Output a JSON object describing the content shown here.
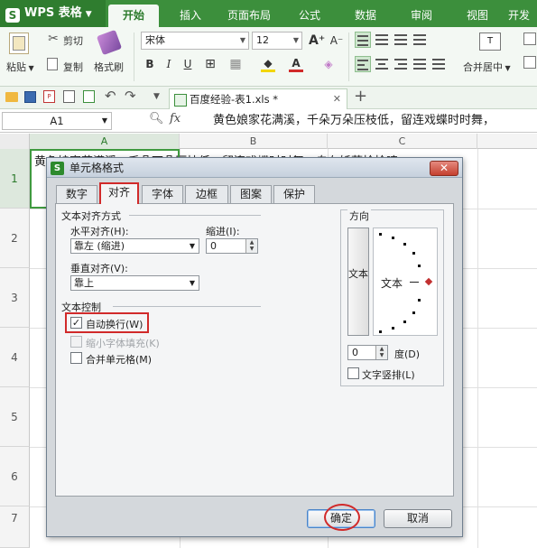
{
  "app": {
    "logo_label": "WPS 表格"
  },
  "ribbon_tabs": [
    "开始",
    "插入",
    "页面布局",
    "公式",
    "数据",
    "审阅",
    "视图",
    "开发"
  ],
  "ribbon": {
    "paste_label": "粘贴",
    "cut_label": "剪切",
    "copy_label": "复制",
    "format_painter_label": "格式刷",
    "font_name": "宋体",
    "font_size": "12",
    "merge_label": "合并居中"
  },
  "doc_tab": {
    "title": "百度经验-表1.xls *"
  },
  "formula_bar": {
    "name_box": "A1",
    "fx": "fx",
    "content": "黄色娘家花满溪，千朵万朵压枝低，留连戏蝶时时舞，"
  },
  "sheet": {
    "columns": [
      "A",
      "B",
      "C"
    ],
    "rows": [
      "1",
      "2",
      "3",
      "4",
      "5",
      "6",
      "7"
    ],
    "a1_visible": "黄色娘家花满溪，千朵万朵压枝低，留连戏蝶时时舞，自在娇莺恰恰啼。"
  },
  "dialog": {
    "title": "单元格格式",
    "tabs": [
      "数字",
      "对齐",
      "字体",
      "边框",
      "图案",
      "保护"
    ],
    "selected_tab": "对齐",
    "text_alignment_section": "文本对齐方式",
    "horizontal_label": "水平对齐(H):",
    "horizontal_value": "靠左 (缩进)",
    "indent_label": "缩进(I):",
    "indent_value": "0",
    "vertical_label": "垂直对齐(V):",
    "vertical_value": "靠上",
    "text_control_section": "文本控制",
    "wrap_text_label": "自动换行(W)",
    "wrap_text_checked": true,
    "shrink_label": "缩小字体填充(K)",
    "merge_cells_label": "合并单元格(M)",
    "orientation_section": "方向",
    "vertical_text_button": "文本",
    "orientation_text": "文本",
    "degrees_value": "0",
    "degrees_label": "度(D)",
    "vertical_text_label": "文字竖排(L)",
    "ok_label": "确定",
    "cancel_label": "取消"
  },
  "colors": {
    "accent": "#3c8f3c",
    "highlight": "#d12a2a"
  }
}
